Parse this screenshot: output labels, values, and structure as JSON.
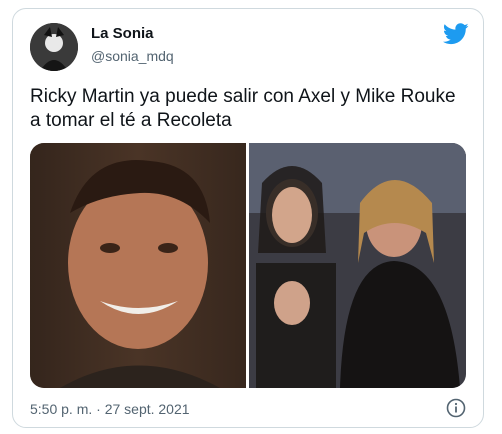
{
  "tweet": {
    "display_name": "La Sonia",
    "handle": "@sonia_mdq",
    "text": "Ricky Martin ya puede salir con Axel  y Mike Rouke a tomar el té a Recoleta",
    "timestamp": "5:50 p. m. · 27 sept. 2021",
    "avatar_icon": "avatar-dark-figure",
    "brand_icon": "twitter-bird-icon",
    "info_icon": "info-icon"
  },
  "media": {
    "images": [
      {
        "name": "photo-left",
        "description_icon": "portrait-photo"
      },
      {
        "name": "photo-right",
        "description_icon": "group-photo"
      }
    ]
  },
  "colors": {
    "brand": "#1d9bf0",
    "text": "#0f1419",
    "secondary_text": "#536471",
    "border": "#cfd9de"
  }
}
